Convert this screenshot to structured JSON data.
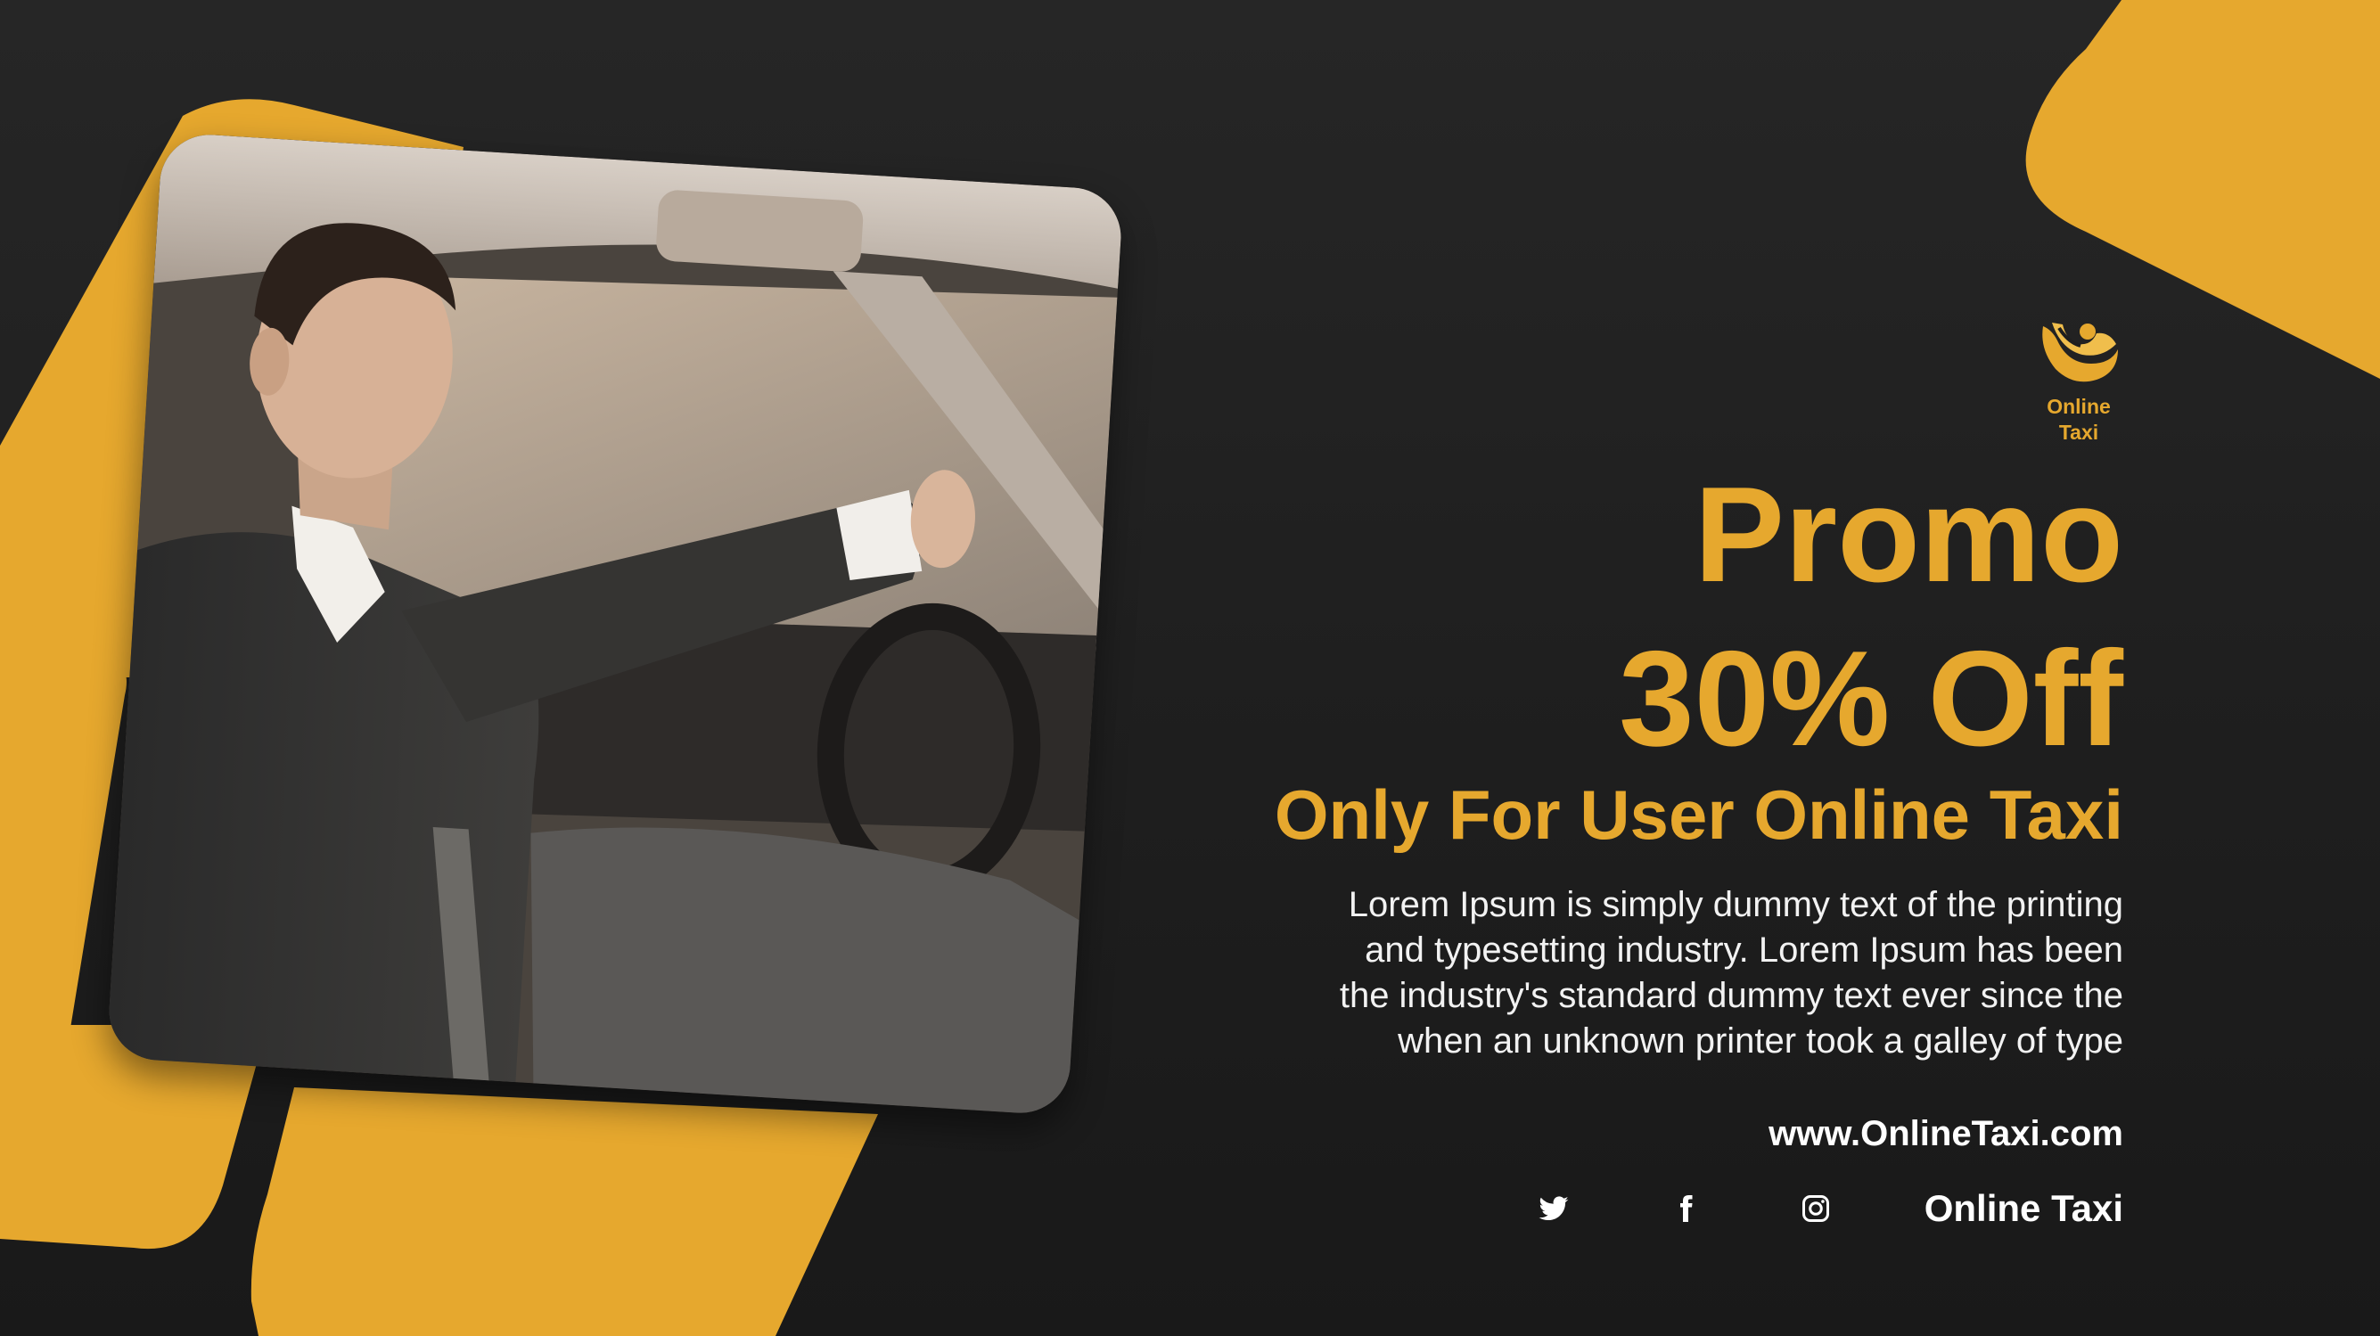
{
  "colors": {
    "accent": "#e6a82e",
    "background": "#1f1f1f",
    "text": "#ffffff"
  },
  "logo": {
    "icon": "taxi-logo-icon",
    "line1": "Online",
    "line2": "Taxi"
  },
  "headline": {
    "promo": "Promo",
    "discount": "30% Off",
    "subtitle": "Only For User Online Taxi"
  },
  "body": {
    "lines": [
      "Lorem Ipsum is simply dummy text of the printing",
      "and typesetting industry. Lorem Ipsum has been",
      "the industry's standard dummy text ever since the",
      "when an unknown printer took a galley of type"
    ]
  },
  "footer": {
    "website": "www.OnlineTaxi.com",
    "social_icons": [
      "twitter-icon",
      "facebook-icon",
      "instagram-icon"
    ],
    "brand": "Online Taxi"
  },
  "photo": {
    "subject": "man-driving-car-photo"
  }
}
